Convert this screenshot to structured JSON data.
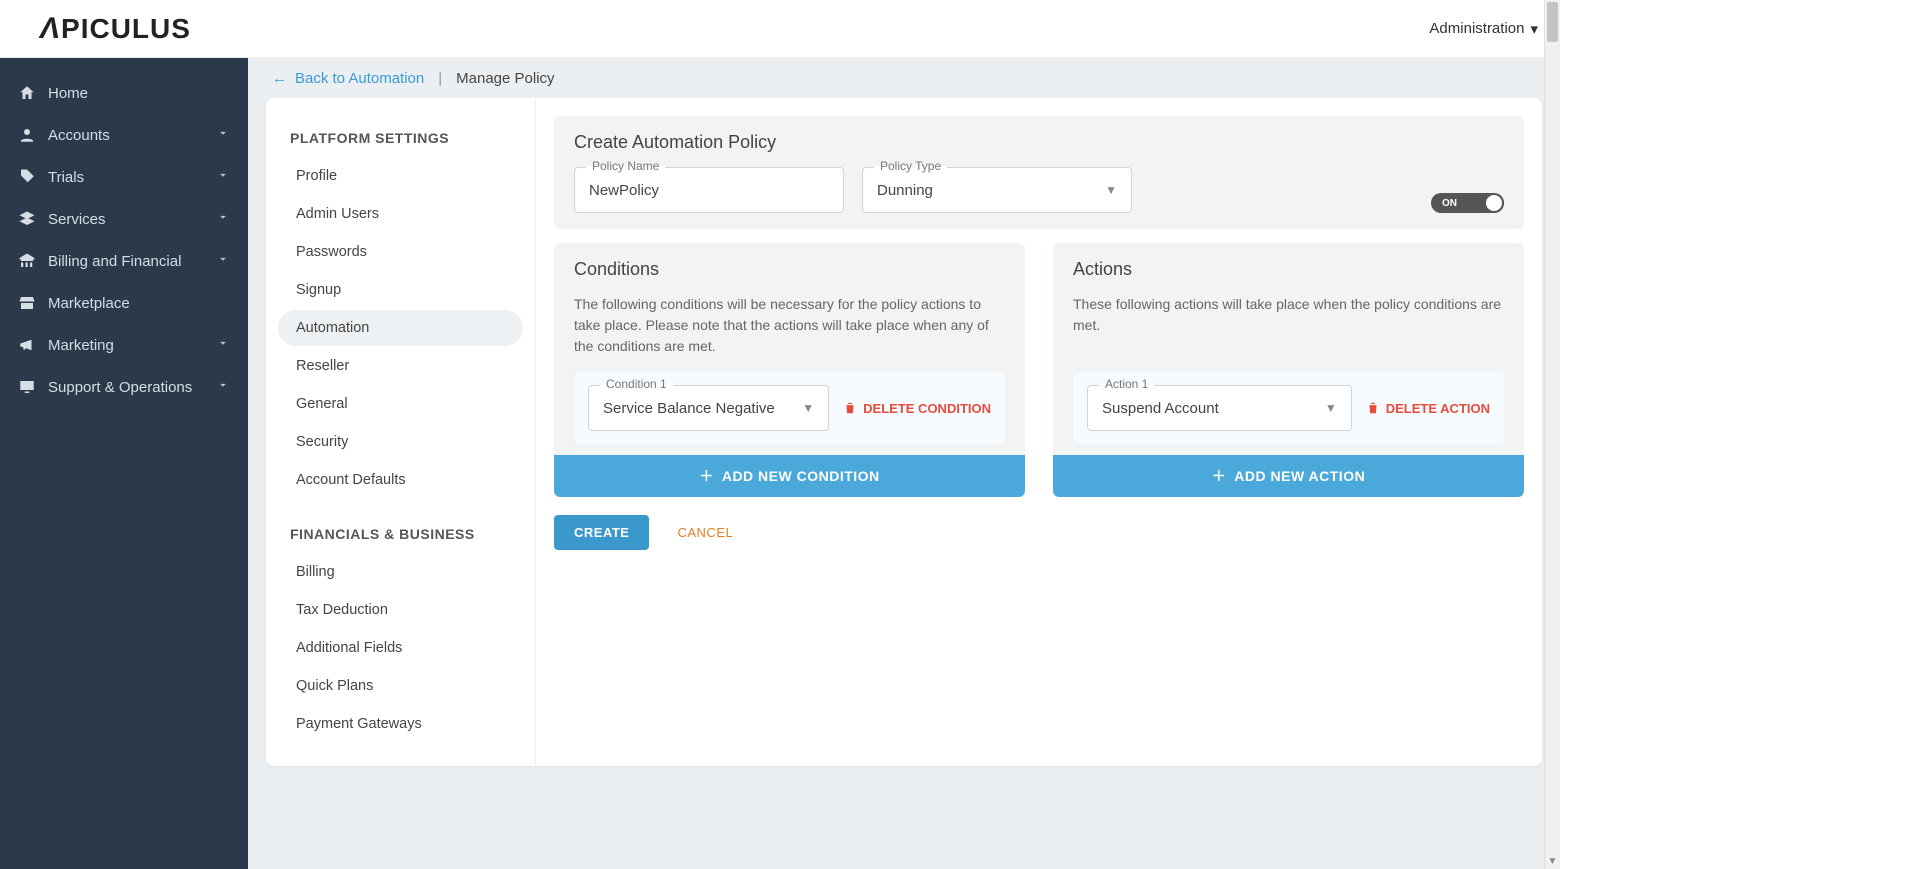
{
  "header": {
    "brand": "APICULUS",
    "admin_label": "Administration"
  },
  "sidebar": {
    "items": [
      {
        "label": "Home",
        "expandable": false
      },
      {
        "label": "Accounts",
        "expandable": true
      },
      {
        "label": "Trials",
        "expandable": true
      },
      {
        "label": "Services",
        "expandable": true
      },
      {
        "label": "Billing and Financial",
        "expandable": true
      },
      {
        "label": "Marketplace",
        "expandable": false
      },
      {
        "label": "Marketing",
        "expandable": true
      },
      {
        "label": "Support & Operations",
        "expandable": true
      }
    ]
  },
  "breadcrumb": {
    "back_label": "Back to Automation",
    "current": "Manage Policy"
  },
  "settings_nav": {
    "groups": [
      {
        "title": "PLATFORM SETTINGS",
        "items": [
          "Profile",
          "Admin Users",
          "Passwords",
          "Signup",
          "Automation",
          "Reseller",
          "General",
          "Security",
          "Account Defaults"
        ],
        "active": "Automation"
      },
      {
        "title": "FINANCIALS & BUSINESS",
        "items": [
          "Billing",
          "Tax Deduction",
          "Additional Fields",
          "Quick Plans",
          "Payment Gateways"
        ],
        "active": null
      }
    ]
  },
  "policy_form": {
    "card_title": "Create Automation Policy",
    "name_label": "Policy Name",
    "name_value": "NewPolicy",
    "type_label": "Policy Type",
    "type_value": "Dunning",
    "toggle_label": "ON"
  },
  "conditions": {
    "title": "Conditions",
    "desc": "The following conditions will be necessary for the policy actions to take place. Please note that the actions will take place when any of the conditions are met.",
    "item_label": "Condition 1",
    "item_value": "Service Balance Negative",
    "delete_label": "DELETE CONDITION",
    "add_label": "ADD NEW CONDITION"
  },
  "actions": {
    "title": "Actions",
    "desc": "These following actions will take place when the policy conditions are met.",
    "item_label": "Action 1",
    "item_value": "Suspend Account",
    "delete_label": "DELETE ACTION",
    "add_label": "ADD NEW ACTION"
  },
  "footer": {
    "create": "CREATE",
    "cancel": "CANCEL"
  }
}
